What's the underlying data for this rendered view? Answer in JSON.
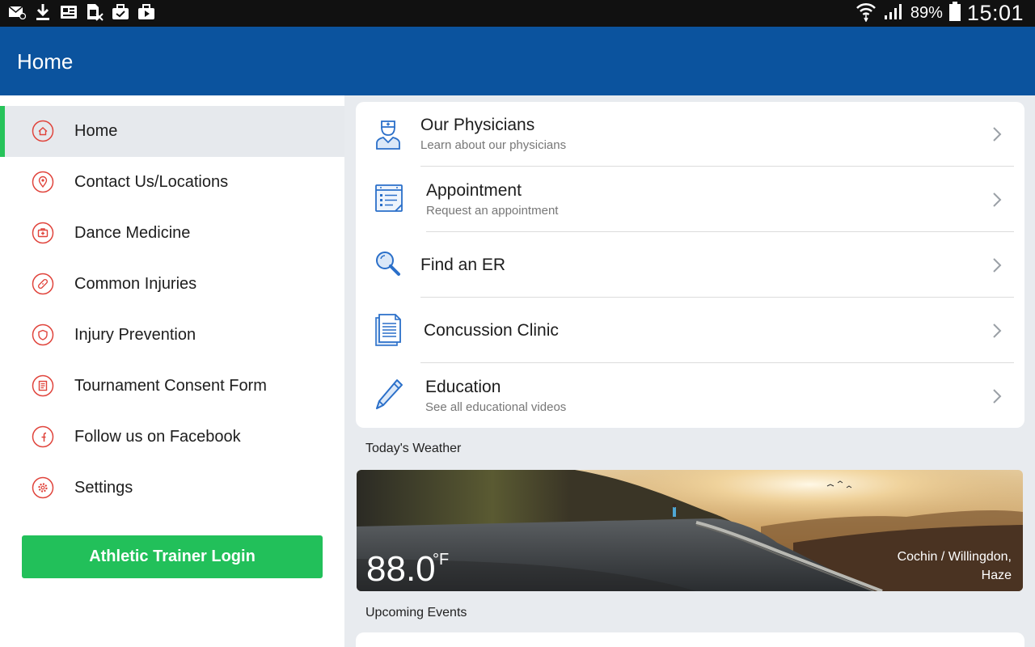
{
  "status_bar": {
    "battery": "89%",
    "time": "15:01",
    "icons": [
      "email-icon",
      "download-icon",
      "news-icon",
      "sim-icon",
      "briefcase-check-icon",
      "play-store-icon"
    ]
  },
  "app_bar": {
    "title": "Home"
  },
  "sidebar": {
    "items": [
      {
        "label": "Home",
        "icon": "home-icon",
        "active": true
      },
      {
        "label": "Contact Us/Locations",
        "icon": "location-pin-icon"
      },
      {
        "label": "Dance Medicine",
        "icon": "medkit-icon"
      },
      {
        "label": "Common Injuries",
        "icon": "bandage-icon"
      },
      {
        "label": "Injury Prevention",
        "icon": "shield-icon"
      },
      {
        "label": "Tournament Consent Form",
        "icon": "form-icon"
      },
      {
        "label": "Follow us on Facebook",
        "icon": "facebook-icon"
      },
      {
        "label": "Settings",
        "icon": "gear-icon"
      }
    ],
    "login_button": "Athletic Trainer Login"
  },
  "menu": {
    "rows": [
      {
        "title": "Our Physicians",
        "subtitle": "Learn about our physicians",
        "icon": "physician-icon"
      },
      {
        "title": "Appointment",
        "subtitle": "Request an appointment",
        "icon": "calendar-list-icon"
      },
      {
        "title": "Find an ER",
        "subtitle": "",
        "icon": "magnifier-icon"
      },
      {
        "title": "Concussion Clinic",
        "subtitle": "",
        "icon": "document-icon"
      },
      {
        "title": "Education",
        "subtitle": "See all educational videos",
        "icon": "pencil-icon"
      }
    ]
  },
  "weather": {
    "heading": "Today's Weather",
    "temperature": "88.0",
    "unit": "°F",
    "location_line1": "Cochin / Willingdon,",
    "location_line2": "Haze"
  },
  "events": {
    "heading": "Upcoming Events"
  },
  "colors": {
    "app_bar": "#0b539e",
    "accent_green": "#22c05a",
    "icon_red": "#e0443c",
    "icon_blue": "#2a6fc9"
  }
}
